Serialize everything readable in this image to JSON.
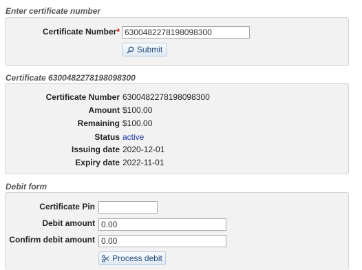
{
  "lookup": {
    "section_title": "Enter certificate number",
    "label": "Certificate Number",
    "required_mark": "*",
    "value": "6300482278198098300",
    "submit_label": "Submit"
  },
  "certificate": {
    "section_title": "Certificate 6300482278198098300",
    "rows": [
      {
        "label": "Certificate Number",
        "value": "6300482278198098300"
      },
      {
        "label": "Amount",
        "value": "$100.00"
      },
      {
        "label": "Remaining",
        "value": "$100.00"
      },
      {
        "label": "Status",
        "value": "active"
      },
      {
        "label": "Issuing date",
        "value": "2020-12-01"
      },
      {
        "label": "Expiry date",
        "value": "2022-11-01"
      }
    ]
  },
  "debit": {
    "section_title": "Debit form",
    "pin_label": "Certificate Pin",
    "pin_value": "",
    "amount_label": "Debit amount",
    "amount_value": "0.00",
    "confirm_label": "Confirm debit amount",
    "confirm_value": "0.00",
    "process_label": "Process debit"
  },
  "icons": {
    "submit": "search-icon",
    "process": "scissors-icon"
  }
}
